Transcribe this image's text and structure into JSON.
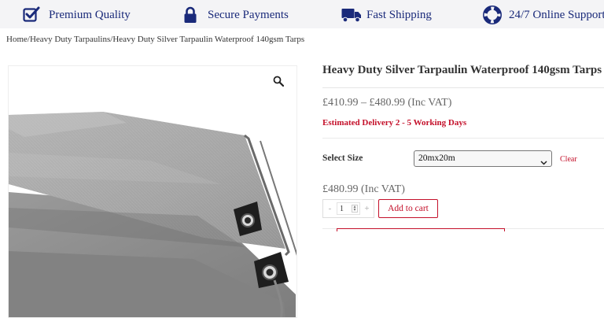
{
  "features": [
    {
      "label": "Premium Quality",
      "icon": "checkbox-icon"
    },
    {
      "label": "Secure Payments",
      "icon": "lock-icon"
    },
    {
      "label": "Fast Shipping",
      "icon": "truck-icon"
    },
    {
      "label": "24/7 Online Support",
      "icon": "lifebuoy-icon"
    }
  ],
  "breadcrumb": {
    "home": "Home",
    "sep": "/",
    "category": "Heavy Duty Tarpaulins",
    "current": "Heavy Duty Silver Tarpaulin Waterproof 140gsm Tarps"
  },
  "product": {
    "title": "Heavy Duty Silver Tarpaulin Waterproof 140gsm Tarps",
    "price_range": "£410.99 – £480.99 (Inc VAT)",
    "delivery": "Estimated Delivery 2 - 5 Working Days",
    "size_label": "Select Size",
    "size_selected": "20mx20m",
    "clear_label": "Clear",
    "selected_price": "£480.99 (Inc VAT)",
    "qty_minus": "-",
    "qty_value": "1",
    "qty_plus": "+",
    "add_to_cart": "Add to cart"
  },
  "colors": {
    "brand_navy": "#1a2a7a",
    "accent_red": "#c4102a",
    "topbar_bg": "#f4f4f6"
  }
}
